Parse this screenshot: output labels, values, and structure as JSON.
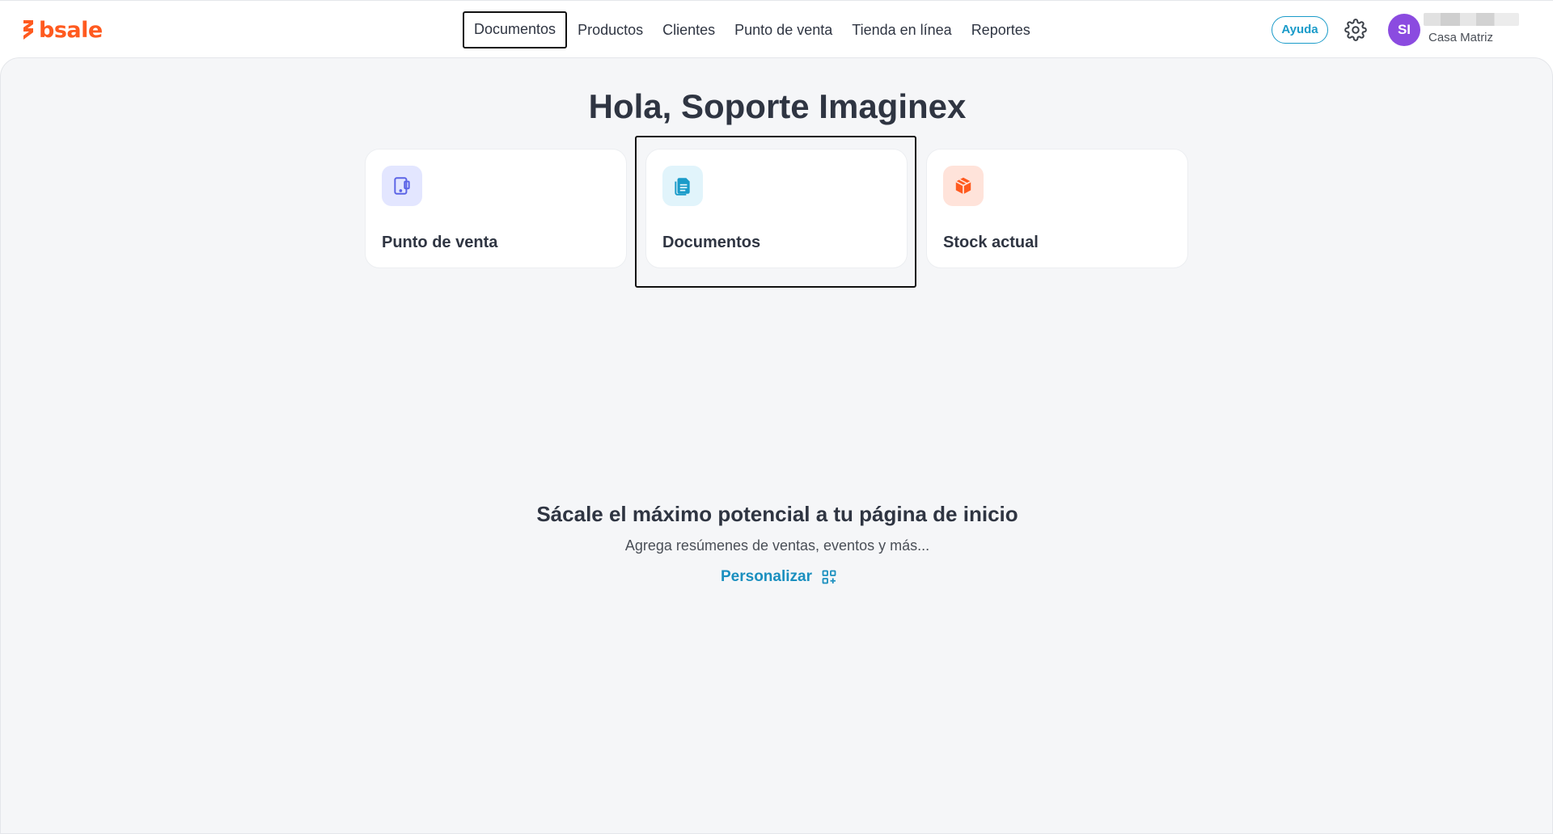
{
  "brand": {
    "logo_text": "bsale",
    "accent_color": "#ff5a1f"
  },
  "nav": {
    "items": [
      {
        "label": "Documentos",
        "active": true
      },
      {
        "label": "Productos"
      },
      {
        "label": "Clientes"
      },
      {
        "label": "Punto de venta"
      },
      {
        "label": "Tienda en línea"
      },
      {
        "label": "Reportes"
      }
    ]
  },
  "header": {
    "help_label": "Ayuda",
    "settings_icon": "gear-icon",
    "avatar_initials": "SI",
    "avatar_color": "#8b4be0",
    "branch": "Casa Matriz"
  },
  "main": {
    "greeting": "Hola, Soporte Imaginex",
    "shortcuts": [
      {
        "label": "Punto de venta",
        "icon": "tablet-pos-icon",
        "icon_bg": "#e3e6ff",
        "icon_color": "#5b63e6"
      },
      {
        "label": "Documentos",
        "icon": "document-icon",
        "icon_bg": "#e1f4fb",
        "icon_color": "#1a9bc9"
      },
      {
        "label": "Stock actual",
        "icon": "box-icon",
        "icon_bg": "#ffe3da",
        "icon_color": "#ff5a1f"
      }
    ],
    "promo": {
      "title": "Sácale el máximo potencial a tu página de inicio",
      "subtitle": "Agrega resúmenes de ventas, eventos y más...",
      "cta": "Personalizar",
      "cta_color": "#1a8fbf"
    }
  }
}
